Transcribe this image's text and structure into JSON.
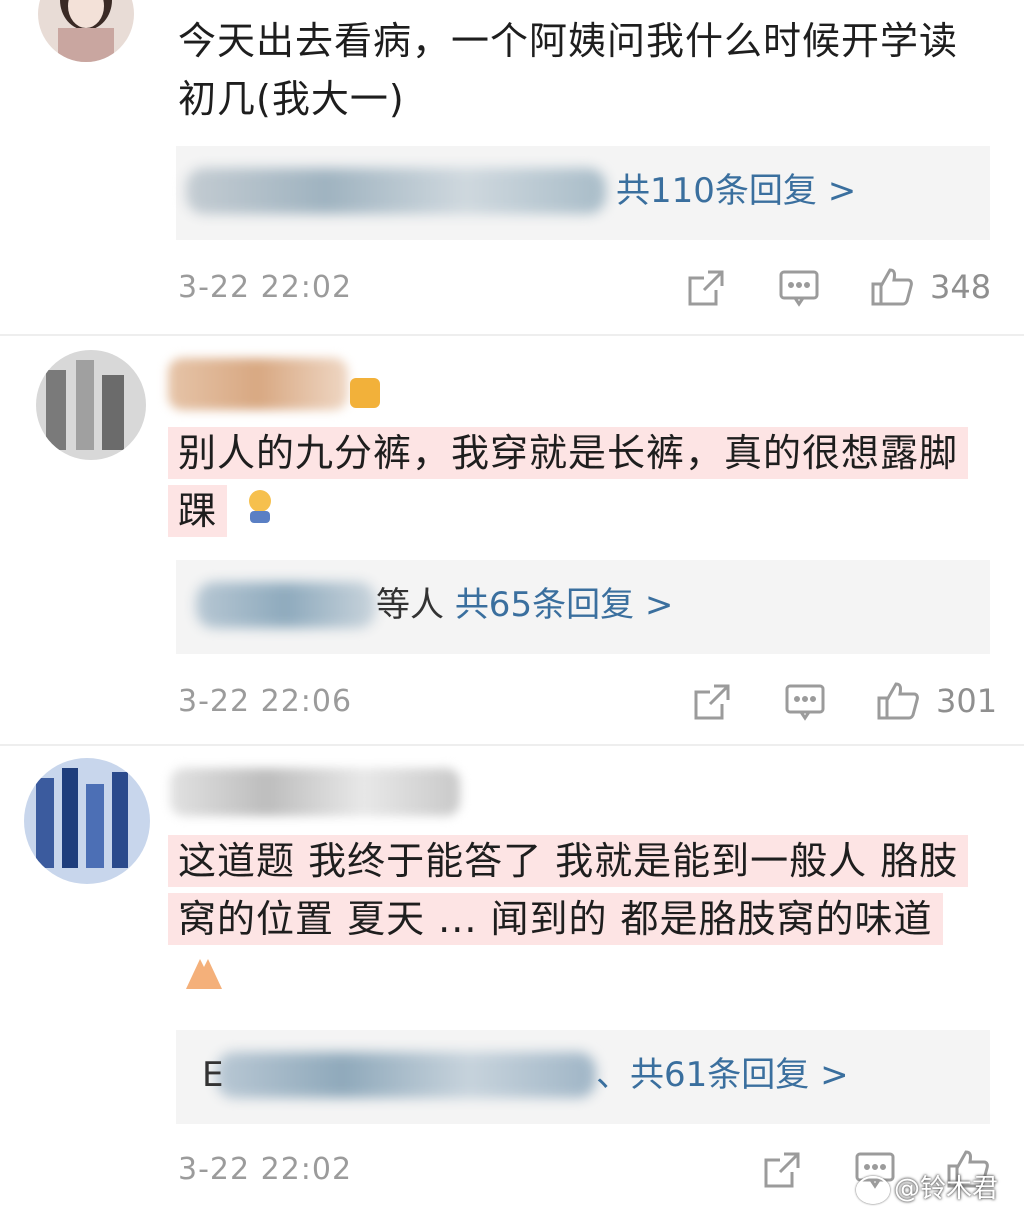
{
  "comments": [
    {
      "text": "今天出去看病，一个阿姨问我什么时候开学读初几(我大一)",
      "reply_prefix": "",
      "reply_count": "共110条回复 >",
      "time": "3-22 22:02",
      "likes": "348",
      "avatar_color": "#c9a6a0"
    },
    {
      "text": "别人的九分裤，我穿就是长裤，真的很想露脚踝",
      "reply_prefix": "等人",
      "reply_count": "共65条回复 >",
      "time": "3-22 22:06",
      "likes": "301",
      "avatar_color": "#8a8a8a"
    },
    {
      "text": "这道题 我终于能答了 我就是能到一般人 胳肢窝的位置 夏天 ... 闻到的 都是胳肢窝的味道",
      "reply_prefix": "E",
      "reply_count": "、共61条回复 >",
      "time": "3-22 22:02",
      "likes": "",
      "avatar_color": "#3b5b9e"
    }
  ],
  "colors": {
    "highlight": "#fde4e4",
    "link": "#3a6f9e",
    "meta": "#9b9b9b"
  },
  "watermark": "@铃木君"
}
